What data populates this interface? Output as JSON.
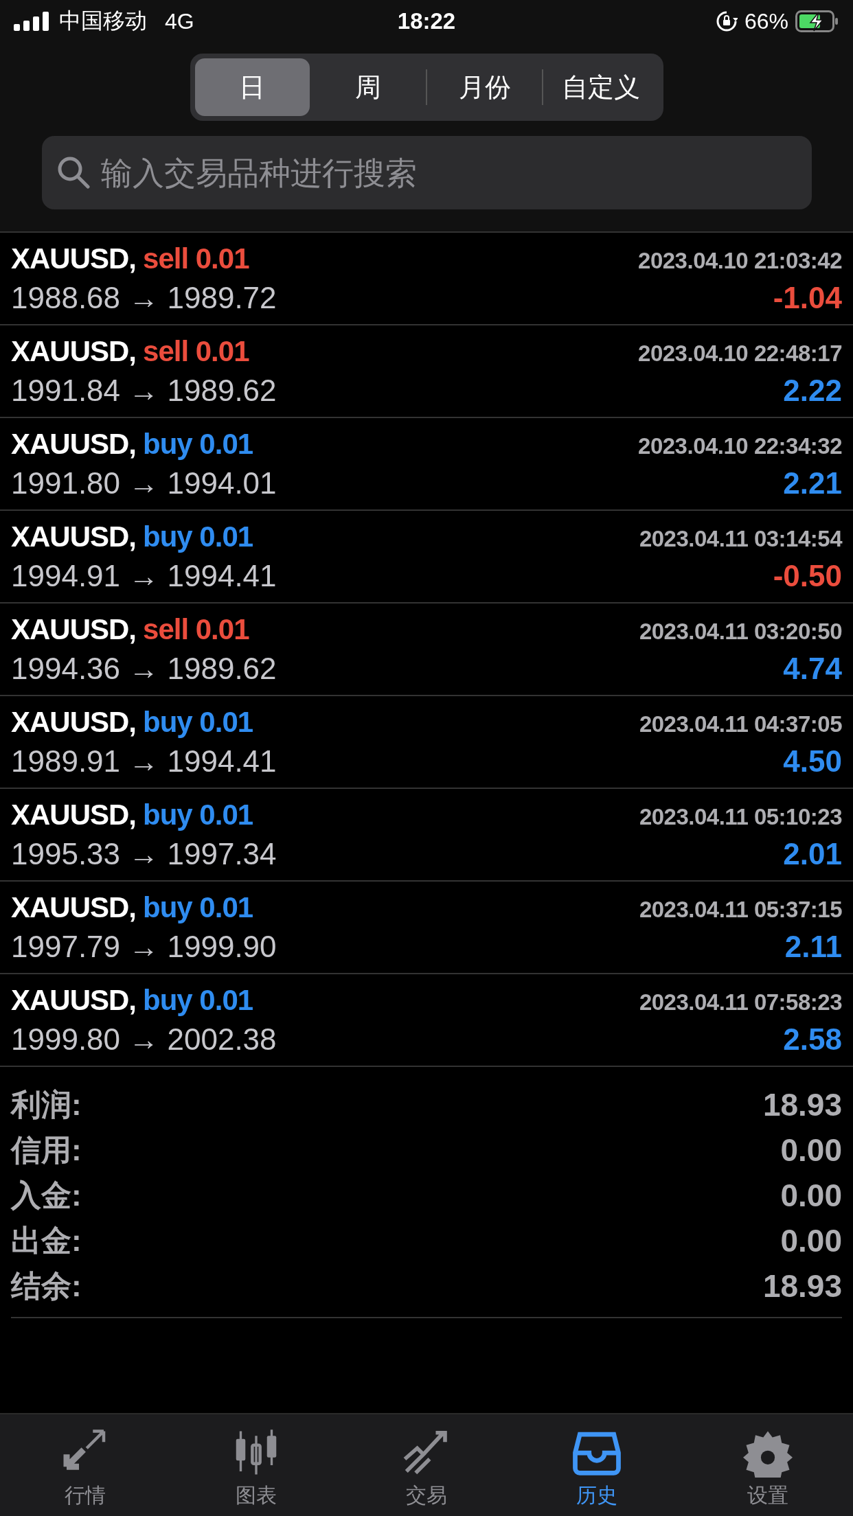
{
  "status_bar": {
    "carrier": "中国移动",
    "network": "4G",
    "time": "18:22",
    "battery": "66%"
  },
  "periods": [
    {
      "label": "日",
      "selected": true
    },
    {
      "label": "周",
      "selected": false
    },
    {
      "label": "月份",
      "selected": false
    },
    {
      "label": "自定义",
      "selected": false
    }
  ],
  "search": {
    "placeholder": "输入交易品种进行搜索"
  },
  "trades": [
    {
      "symbol": "XAUUSD,",
      "kind": "sell",
      "order": "sell 0.01",
      "time": "2023.04.10 21:03:42",
      "prices": "1988.68 → 1989.72",
      "profit": "-1.04",
      "loss": true
    },
    {
      "symbol": "XAUUSD,",
      "kind": "sell",
      "order": "sell 0.01",
      "time": "2023.04.10 22:48:17",
      "prices": "1991.84 → 1989.62",
      "profit": "2.22",
      "loss": false
    },
    {
      "symbol": "XAUUSD,",
      "kind": "buy",
      "order": "buy 0.01",
      "time": "2023.04.10 22:34:32",
      "prices": "1991.80 → 1994.01",
      "profit": "2.21",
      "loss": false
    },
    {
      "symbol": "XAUUSD,",
      "kind": "buy",
      "order": "buy 0.01",
      "time": "2023.04.11 03:14:54",
      "prices": "1994.91 → 1994.41",
      "profit": "-0.50",
      "loss": true
    },
    {
      "symbol": "XAUUSD,",
      "kind": "sell",
      "order": "sell 0.01",
      "time": "2023.04.11 03:20:50",
      "prices": "1994.36 → 1989.62",
      "profit": "4.74",
      "loss": false
    },
    {
      "symbol": "XAUUSD,",
      "kind": "buy",
      "order": "buy 0.01",
      "time": "2023.04.11 04:37:05",
      "prices": "1989.91 → 1994.41",
      "profit": "4.50",
      "loss": false
    },
    {
      "symbol": "XAUUSD,",
      "kind": "buy",
      "order": "buy 0.01",
      "time": "2023.04.11 05:10:23",
      "prices": "1995.33 → 1997.34",
      "profit": "2.01",
      "loss": false
    },
    {
      "symbol": "XAUUSD,",
      "kind": "buy",
      "order": "buy 0.01",
      "time": "2023.04.11 05:37:15",
      "prices": "1997.79 → 1999.90",
      "profit": "2.11",
      "loss": false
    },
    {
      "symbol": "XAUUSD,",
      "kind": "buy",
      "order": "buy 0.01",
      "time": "2023.04.11 07:58:23",
      "prices": "1999.80 → 2002.38",
      "profit": "2.58",
      "loss": false
    }
  ],
  "summary": [
    {
      "label": "利润:",
      "value": "18.93"
    },
    {
      "label": "信用:",
      "value": "0.00"
    },
    {
      "label": "入金:",
      "value": "0.00"
    },
    {
      "label": "出金:",
      "value": "0.00"
    },
    {
      "label": "结余:",
      "value": "18.93"
    }
  ],
  "tab_bar": [
    {
      "kind": "quotes",
      "label": "行情",
      "selected": false
    },
    {
      "kind": "chart",
      "label": "图表",
      "selected": false
    },
    {
      "kind": "trade",
      "label": "交易",
      "selected": false
    },
    {
      "kind": "history",
      "label": "历史",
      "selected": true
    },
    {
      "kind": "settings",
      "label": "设置",
      "selected": false
    }
  ]
}
